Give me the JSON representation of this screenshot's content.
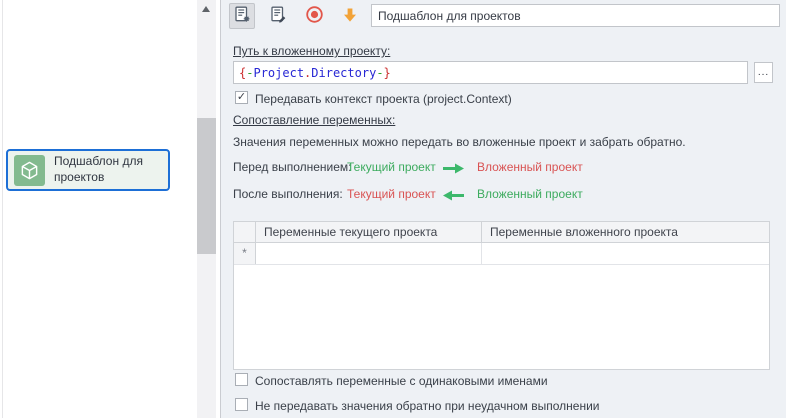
{
  "colors": {
    "selection_blue": "#1d6fd6",
    "node_icon_green": "#83ba8f",
    "source_green": "#3cab5e",
    "target_red": "#d95353",
    "arrow_green": "#3cb86b",
    "record_red": "#e2564a",
    "download_orange": "#f2a338",
    "macro_brace_red": "#cc2f2f",
    "macro_dash_green": "#2ba32b",
    "macro_name_blue": "#2727d4"
  },
  "left_panel": {
    "node": {
      "label": "Подшаблон для проектов",
      "icon": "cube-icon"
    }
  },
  "toolbar": {
    "buttons": [
      {
        "icon": "action-properties-icon",
        "pressed": true
      },
      {
        "icon": "action-edit-icon",
        "pressed": false
      },
      {
        "icon": "record-icon",
        "pressed": false
      },
      {
        "icon": "download-arrow-icon",
        "pressed": false
      }
    ],
    "name_value": "Подшаблон для проектов"
  },
  "form": {
    "path_section_label": "Путь к вложенному проекту:",
    "path_value": "{-Project.Directory-}",
    "path_tokens": [
      {
        "text": "{",
        "color": "#cc2f2f"
      },
      {
        "text": "-",
        "color": "#2ba32b"
      },
      {
        "text": "Project",
        "color": "#2727d4"
      },
      {
        "text": ".",
        "color": "#cc2f2f"
      },
      {
        "text": "Directory",
        "color": "#2727d4"
      },
      {
        "text": "-",
        "color": "#2ba32b"
      },
      {
        "text": "}",
        "color": "#cc2f2f"
      }
    ],
    "browse_button_label": "...",
    "pass_context_checkbox": {
      "label": "Передавать контекст проекта (project.Context)",
      "checked": true
    },
    "mapping_section_label": "Сопоставление переменных:",
    "mapping_hint": "Значения переменных можно передать во вложенные проект и забрать обратно.",
    "before_execution": {
      "label": "Перед выполнением:",
      "from": "Текущий проект",
      "to": "Вложенный проект",
      "direction": "right"
    },
    "after_execution": {
      "label": "После выполнения:",
      "from": "Текущий проект",
      "to": "Вложенный проект",
      "direction": "left"
    },
    "variables_table": {
      "columns": [
        "Переменные текущего проекта",
        "Переменные вложенного проекта"
      ],
      "new_row_marker": "*",
      "rows": []
    },
    "match_names_checkbox": {
      "label": "Сопоставлять переменные с одинаковыми именами",
      "checked": false
    },
    "no_backward_checkbox": {
      "label": "Не передавать значения обратно при неудачном выполнении",
      "checked": false
    }
  }
}
